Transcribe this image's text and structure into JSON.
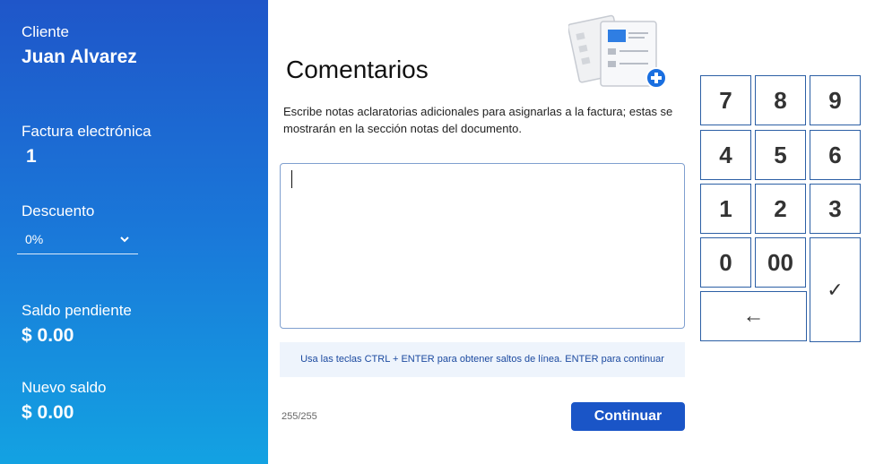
{
  "sidebar": {
    "client_label": "Cliente",
    "client_name": "Juan Alvarez",
    "invoice_label": "Factura electrónica",
    "invoice_number": "1",
    "discount_label": "Descuento",
    "discount_value": "0%",
    "pending_label": "Saldo pendiente",
    "pending_value": "$ 0.00",
    "new_balance_label": "Nuevo saldo",
    "new_balance_value": "$ 0.00"
  },
  "main": {
    "title": "Comentarios",
    "description": "Escribe notas aclaratorias adicionales para asignarlas a la factura; estas se mostrarán en la sección notas del documento.",
    "comment_value": "",
    "hint": "Usa las teclas CTRL + ENTER para obtener saltos de línea. ENTER para continuar",
    "counter": "255/255",
    "continue_label": "Continuar"
  },
  "keypad": {
    "k7": "7",
    "k8": "8",
    "k9": "9",
    "k4": "4",
    "k5": "5",
    "k6": "6",
    "k1": "1",
    "k2": "2",
    "k3": "3",
    "k0": "0",
    "k00": "00",
    "backspace": "←",
    "confirm": "✓"
  },
  "colors": {
    "sidebar_top": "#1f56c9",
    "sidebar_bottom": "#13a2e2",
    "accent": "#1a55c7",
    "hint_bg": "#eef4fc",
    "key_border": "#2c5fa5"
  }
}
